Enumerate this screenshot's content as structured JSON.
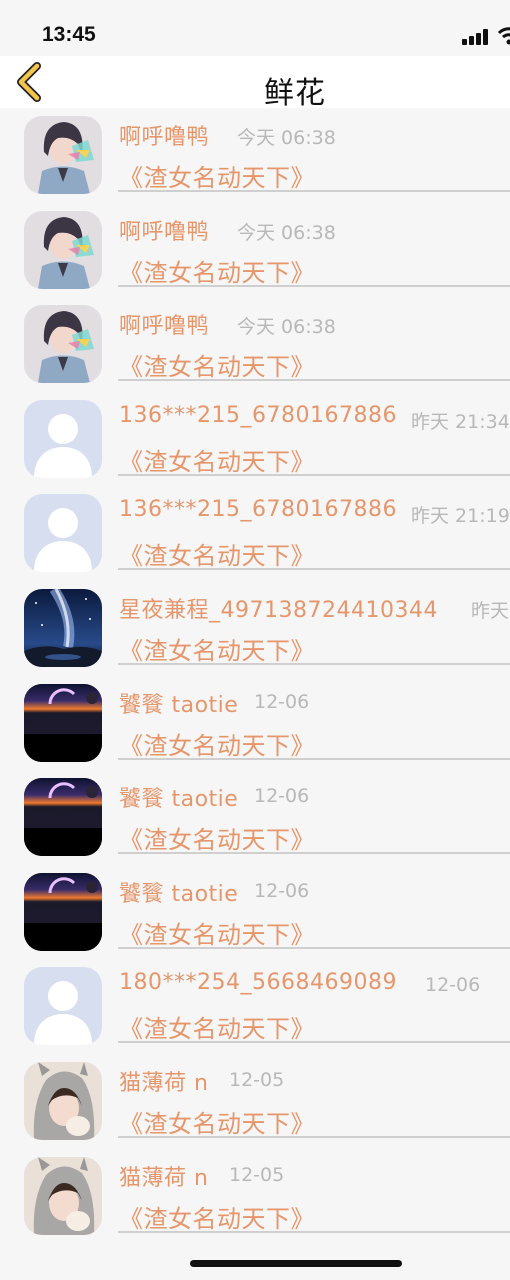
{
  "status_bar": {
    "time": "13:45"
  },
  "nav": {
    "title": "鲜花",
    "back_icon": "chevron-left-icon"
  },
  "colors": {
    "accent": "#e6966b",
    "muted": "#b8b8b8",
    "back": "#f3c64a"
  },
  "rows": [
    {
      "user": "啊呼噜鸭",
      "time": "今天 06:38",
      "book": "《渣女名动天下》",
      "avatar": "anime"
    },
    {
      "user": "啊呼噜鸭",
      "time": "今天 06:38",
      "book": "《渣女名动天下》",
      "avatar": "anime"
    },
    {
      "user": "啊呼噜鸭",
      "time": "今天 06:38",
      "book": "《渣女名动天下》",
      "avatar": "anime"
    },
    {
      "user": "136***215_6780167886",
      "time": "昨天 21:34",
      "book": "《渣女名动天下》",
      "avatar": "default"
    },
    {
      "user": "136***215_6780167886",
      "time": "昨天 21:19",
      "book": "《渣女名动天下》",
      "avatar": "default"
    },
    {
      "user": "星夜兼程_497138724410344",
      "time": "昨天",
      "book": "《渣女名动天下》",
      "avatar": "galaxy"
    },
    {
      "user": "饕餮 taotie",
      "time": "12-06",
      "book": "《渣女名动天下》",
      "avatar": "sunset"
    },
    {
      "user": "饕餮 taotie",
      "time": "12-06",
      "book": "《渣女名动天下》",
      "avatar": "sunset"
    },
    {
      "user": "饕餮 taotie",
      "time": "12-06",
      "book": "《渣女名动天下》",
      "avatar": "sunset"
    },
    {
      "user": "180***254_5668469089",
      "time": "12-06",
      "book": "《渣女名动天下》",
      "avatar": "default"
    },
    {
      "user": "猫薄荷 n",
      "time": "12-05",
      "book": "《渣女名动天下》",
      "avatar": "girl"
    },
    {
      "user": "猫薄荷 n",
      "time": "12-05",
      "book": "《渣女名动天下》",
      "avatar": "girl"
    }
  ]
}
